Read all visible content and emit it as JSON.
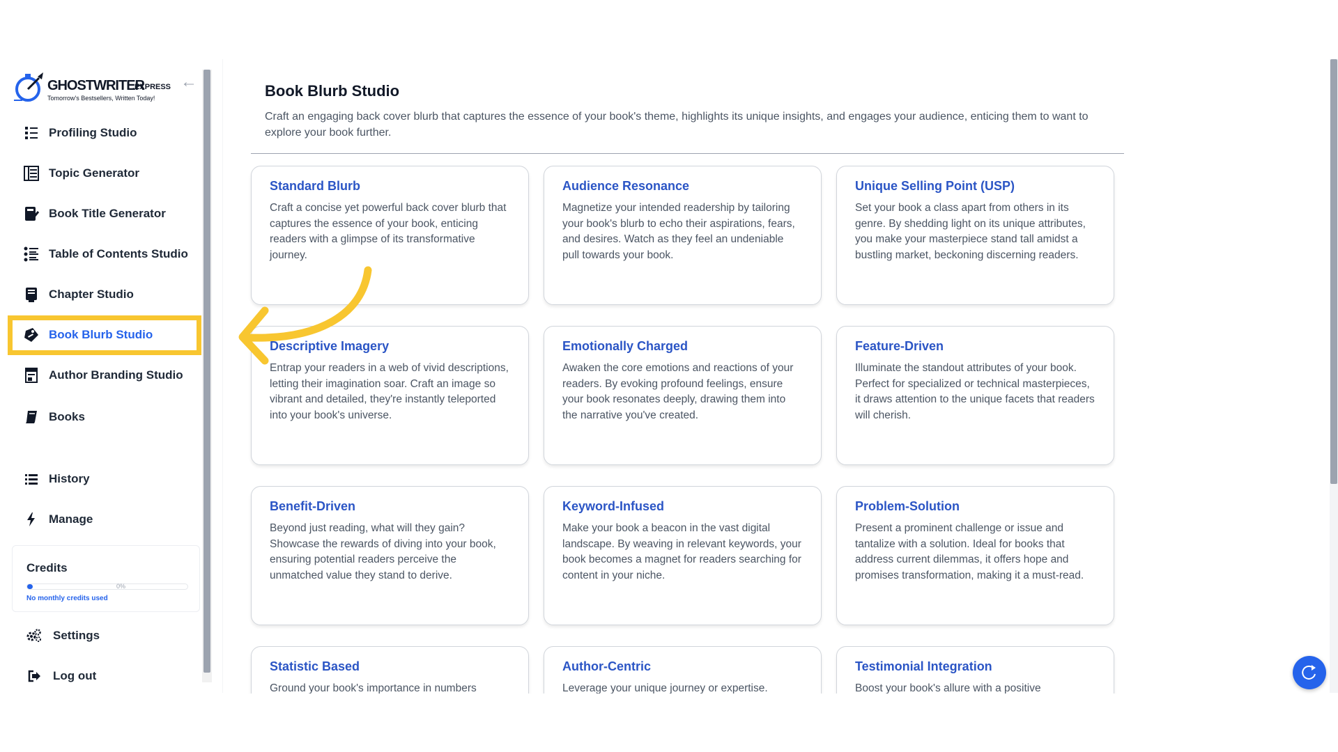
{
  "brand": {
    "name_part1": "GHOSTWRITER",
    "name_part2": ".EXPRESS",
    "tagline": "Tomorrow's Bestsellers, Written Today!"
  },
  "sidebar": {
    "items": [
      {
        "label": "Profiling Studio",
        "icon": "list-numbered-icon"
      },
      {
        "label": "Topic Generator",
        "icon": "topic-list-icon"
      },
      {
        "label": "Book Title Generator",
        "icon": "book-pen-icon"
      },
      {
        "label": "Table of Contents Studio",
        "icon": "toc-icon"
      },
      {
        "label": "Chapter Studio",
        "icon": "chapter-icon"
      },
      {
        "label": "Book Blurb Studio",
        "icon": "blurb-icon",
        "active": true
      },
      {
        "label": "Author Branding Studio",
        "icon": "branding-icon"
      },
      {
        "label": "Books",
        "icon": "book-icon"
      },
      {
        "label": "History",
        "icon": "history-list-icon"
      },
      {
        "label": "Manage",
        "icon": "bolt-icon"
      }
    ],
    "credits": {
      "title": "Credits",
      "percent": "0%",
      "note": "No monthly credits used"
    },
    "footer": [
      {
        "label": "Settings",
        "icon": "gears-icon"
      },
      {
        "label": "Log out",
        "icon": "logout-icon"
      }
    ]
  },
  "main": {
    "title": "Book Blurb Studio",
    "description": "Craft an engaging back cover blurb that captures the essence of your book's theme, highlights its unique insights, and engages your audience, enticing them to want to explore your book further.",
    "cards": [
      {
        "title": "Standard Blurb",
        "text": "Craft a concise yet powerful back cover blurb that captures the essence of your book, enticing readers with a glimpse of its transformative journey."
      },
      {
        "title": "Audience Resonance",
        "text": "Magnetize your intended readership by tailoring your book's blurb to echo their aspirations, fears, and desires. Watch as they feel an undeniable pull towards your book."
      },
      {
        "title": "Unique Selling Point (USP)",
        "text": "Set your book a class apart from others in its genre. By shedding light on its unique attributes, you make your masterpiece stand tall amidst a bustling market, beckoning discerning readers."
      },
      {
        "title": "Descriptive Imagery",
        "text": "Entrap your readers in a web of vivid descriptions, letting their imagination soar. Craft an image so vibrant and detailed, they're instantly teleported into your book's universe."
      },
      {
        "title": "Emotionally Charged",
        "text": "Awaken the core emotions and reactions of your readers. By evoking profound feelings, ensure your book resonates deeply, drawing them into the narrative you've created."
      },
      {
        "title": "Feature-Driven",
        "text": "Illuminate the standout attributes of your book. Perfect for specialized or technical masterpieces, it draws attention to the unique facets that readers will cherish."
      },
      {
        "title": "Benefit-Driven",
        "text": "Beyond just reading, what will they gain? Showcase the rewards of diving into your book, ensuring potential readers perceive the unmatched value they stand to derive."
      },
      {
        "title": "Keyword-Infused",
        "text": "Make your book a beacon in the vast digital landscape. By weaving in relevant keywords, your book becomes a magnet for readers searching for content in your niche."
      },
      {
        "title": "Problem-Solution",
        "text": "Present a prominent challenge or issue and tantalize with a solution. Ideal for books that address current dilemmas, it offers hope and promises transformation, making it a must-read."
      },
      {
        "title": "Statistic Based",
        "text": "Ground your book's importance in numbers"
      },
      {
        "title": "Author-Centric",
        "text": "Leverage your unique journey or expertise."
      },
      {
        "title": "Testimonial Integration",
        "text": "Boost your book's allure with a positive"
      }
    ]
  },
  "colors": {
    "accent": "#2563eb",
    "card_title": "#2b55c5",
    "highlight": "#f8c630"
  }
}
